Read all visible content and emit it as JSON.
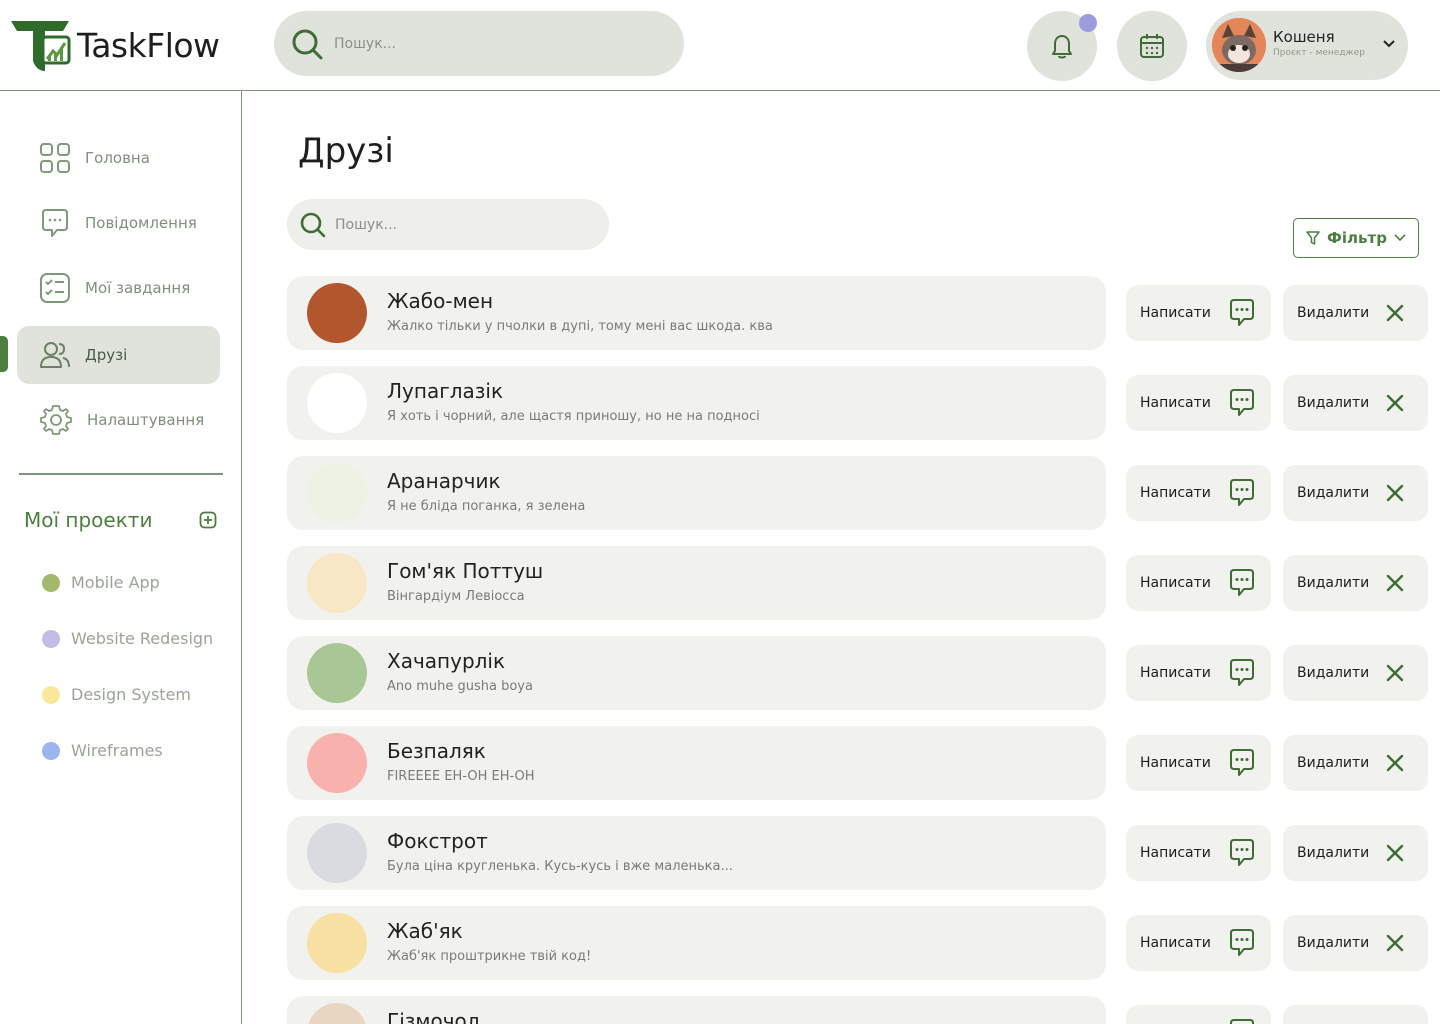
{
  "app": {
    "name": "TaskFlow"
  },
  "header": {
    "search_placeholder": "Пошук...",
    "user": {
      "name": "Кошеня",
      "role": "Проєкт - менеджер"
    }
  },
  "sidebar": {
    "items": [
      {
        "label": "Головна",
        "icon": "grid-icon"
      },
      {
        "label": "Повідомлення",
        "icon": "chat-icon"
      },
      {
        "label": "Мої завдання",
        "icon": "checklist-icon"
      },
      {
        "label": "Друзі",
        "icon": "users-icon",
        "active": true
      },
      {
        "label": "Налаштування",
        "icon": "gear-icon"
      }
    ],
    "projects_title": "Мої проекти",
    "projects": [
      {
        "label": "Mobile App",
        "color": "#a3b86c"
      },
      {
        "label": "Website Redesign",
        "color": "#c3bde6"
      },
      {
        "label": "Design System",
        "color": "#fbe89d"
      },
      {
        "label": "Wireframes",
        "color": "#9ab6ec"
      }
    ]
  },
  "main": {
    "title": "Друзі",
    "search_placeholder": "Пошук...",
    "filter_label": "Фільтр",
    "write_label": "Написати",
    "remove_label": "Видалити",
    "friends": [
      {
        "name": "Жабо-мен",
        "status": "Жалко тільки у пчолки в дупі, тому мені вас шкода. ква",
        "avatar_color": "#b2562e"
      },
      {
        "name": "Лупаглазік",
        "status": "Я хоть і чорний, але щастя приношу, но не на подносі",
        "avatar_color": "#ffffff"
      },
      {
        "name": "Аранарчик",
        "status": "Я не бліда поганка, я зелена",
        "avatar_color": "#eef2e4"
      },
      {
        "name": "Гом'як Поттуш",
        "status": "Вінгардіум Левіосса",
        "avatar_color": "#f7e7c5"
      },
      {
        "name": "Хачапурлік",
        "status": "Ano muhe gusha boya",
        "avatar_color": "#a9c795"
      },
      {
        "name": "Безпаляк",
        "status": "FIREEEE EH-OH EH-OH",
        "avatar_color": "#f9b1ad"
      },
      {
        "name": "Фокстрот",
        "status": "Була ціна кругленька. Кусь-кусь і вже маленька...",
        "avatar_color": "#d9dbe0"
      },
      {
        "name": "Жаб'як",
        "status": "Жаб'як проштрикне твій код!",
        "avatar_color": "#f7e0a2"
      },
      {
        "name": "Гізмочол",
        "status": "",
        "avatar_color": "#e9d6c2"
      }
    ]
  }
}
